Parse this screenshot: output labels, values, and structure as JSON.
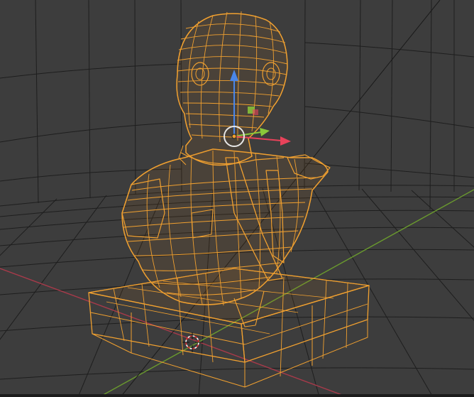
{
  "scene": {
    "colors": {
      "background": "#3d3d3d",
      "grid": "#1e1e1e",
      "wireframe": "#f0a030",
      "wireframe_bright": "#ffb447",
      "axis_x": "#a83a4a",
      "axis_y": "#6a9a2e",
      "gizmo_x": "#e8425a",
      "gizmo_y": "#8ac83a",
      "gizmo_z": "#4a86e8",
      "origin": "#e6e6e6",
      "cursor_red": "#e03030",
      "cursor_white": "#ffffff",
      "diagonal": "#1a1a1a"
    },
    "object": {
      "type": "mesh",
      "display": "wireframe",
      "selected": true,
      "subject": "bust-on-pedestal"
    },
    "gizmo": {
      "type": "move",
      "axes": [
        "x",
        "y",
        "z"
      ]
    },
    "icons": [
      "3d-cursor-icon",
      "object-origin-icon",
      "move-gizmo-icon"
    ]
  }
}
